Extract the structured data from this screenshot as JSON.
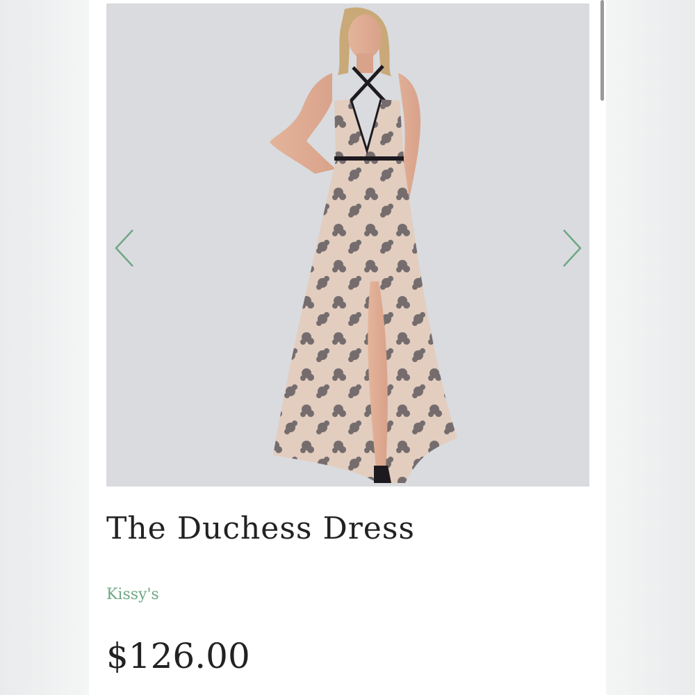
{
  "product": {
    "title": "The Duchess Dress",
    "brand": "Kissy's",
    "price": "$126.00"
  },
  "gallery": {
    "prev_icon": "chevron-left-icon",
    "next_icon": "chevron-right-icon",
    "image_subject": "woman-in-floral-lace-halter-maxi-dress"
  },
  "colors": {
    "accent": "#6fa685",
    "gallery_background": "#d9dbdf",
    "text": "#222222"
  }
}
